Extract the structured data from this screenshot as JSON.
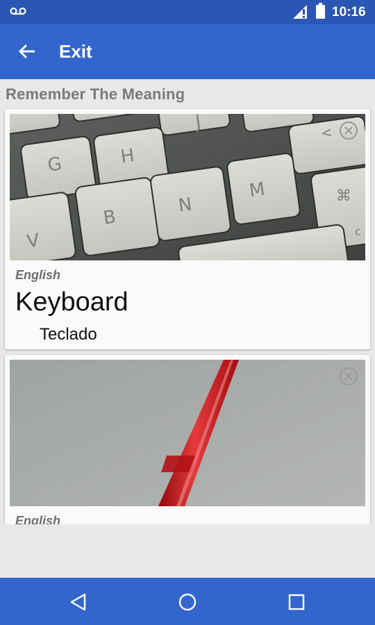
{
  "status_bar": {
    "time": "10:16",
    "icons": [
      "voicemail-icon",
      "signal-icon",
      "battery-icon"
    ]
  },
  "app_bar": {
    "back_icon": "arrow-left-icon",
    "title": "Exit"
  },
  "section_title": "Remember The Meaning",
  "cards": [
    {
      "image": "keyboard-photo",
      "language": "English",
      "word": "Keyboard",
      "translation": "Teclado",
      "close_icon": "close-circle-icon"
    },
    {
      "image": "red-pen-photo",
      "language": "English",
      "word": "",
      "translation": "",
      "close_icon": "close-circle-icon"
    }
  ],
  "nav_bar": {
    "icons": [
      "back-triangle-icon",
      "home-circle-icon",
      "recents-square-icon"
    ]
  },
  "colors": {
    "status_bar": "#2a56b4",
    "app_bar": "#3366cc",
    "background": "#e8e8e8",
    "card": "#fafafa",
    "section_title": "#7a7a7a"
  }
}
